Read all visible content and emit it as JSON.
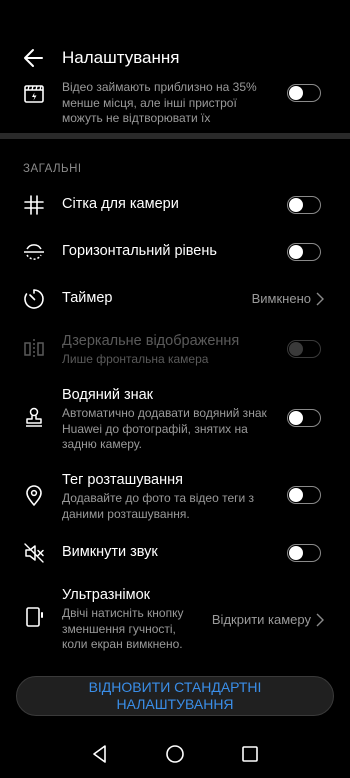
{
  "header": {
    "title": "Налаштування"
  },
  "video_note": {
    "text": "Відео займають приблизно на 35% менше місця, але інші пристрої можуть не відтворювати їх",
    "toggle_on": false
  },
  "section_general": "ЗАГАЛЬНІ",
  "settings": {
    "grid": {
      "label": "Сітка для камери",
      "toggle_on": false
    },
    "level": {
      "label": "Горизонтальний рівень",
      "toggle_on": false
    },
    "timer": {
      "label": "Таймер",
      "value": "Вимкнено"
    },
    "mirror": {
      "label": "Дзеркальне відображення",
      "sub": "Лише фронтальна камера",
      "enabled": false
    },
    "watermark": {
      "label": "Водяний знак",
      "sub": "Автоматично додавати водяний знак Huawei до фотографій, знятих на задню камеру.",
      "toggle_on": false
    },
    "location": {
      "label": "Тег розташування",
      "sub": "Додавайте до фото та відео теги з даними розташування.",
      "toggle_on": false
    },
    "mute": {
      "label": "Вимкнути звук",
      "toggle_on": false
    },
    "ultrasnap": {
      "label": "Ультразнімок",
      "sub": "Двічі натисніть кнопку зменшення гучності, коли екран вимкнено.",
      "value": "Відкрити камеру"
    }
  },
  "reset_button": "ВІДНОВИТИ СТАНДАРТНІ НАЛАШТУВАННЯ",
  "colors": {
    "accent": "#3a8ee8",
    "background": "#000000",
    "divider": "#2a2a2a"
  }
}
